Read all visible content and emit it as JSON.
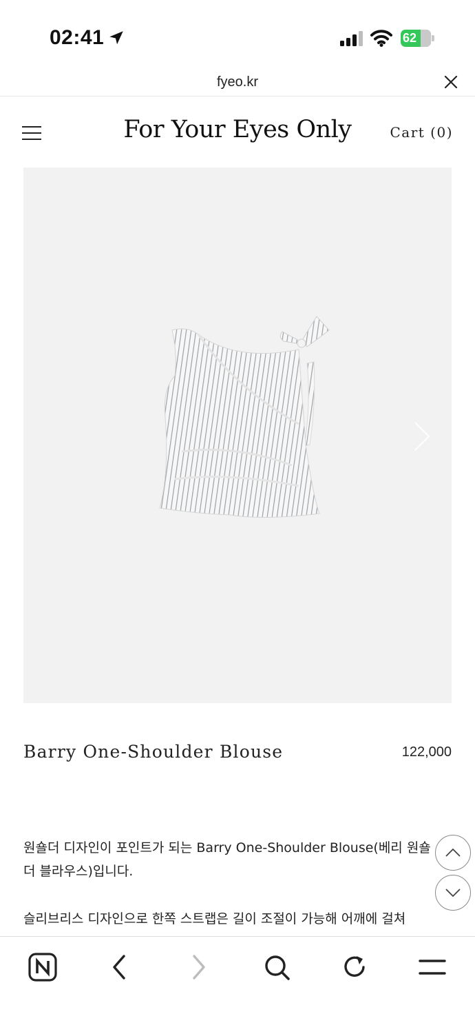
{
  "status_bar": {
    "time": "02:41",
    "battery_level": "62",
    "battery_color": "#34c759"
  },
  "browser": {
    "url": "fyeo.kr"
  },
  "header": {
    "site_title": "For Your Eyes Only",
    "cart_label": "Cart (0)"
  },
  "product": {
    "name": "Barry One-Shoulder Blouse",
    "price": "122,000",
    "description": [
      "원숄더 디자인이 포인트가 되는 Barry One-Shoulder Blouse(베리 원숄더 블라우스)입니다.",
      "슬리브리스 디자인으로 한쪽 스트랩은 길이 조절이 가능해 어깨에 걸쳐"
    ]
  },
  "icons": {
    "location": "location-arrow-icon",
    "signal": "cellular-signal-icon",
    "wifi": "wifi-icon",
    "close": "close-icon",
    "menu": "hamburger-menu-icon",
    "next": "chevron-right-icon",
    "scroll_up": "chevron-up-icon",
    "scroll_down": "chevron-down-icon",
    "naver": "naver-n-icon",
    "back": "back-arrow-icon",
    "forward": "forward-arrow-icon",
    "search": "search-icon",
    "reload": "reload-icon",
    "more": "more-menu-icon"
  }
}
